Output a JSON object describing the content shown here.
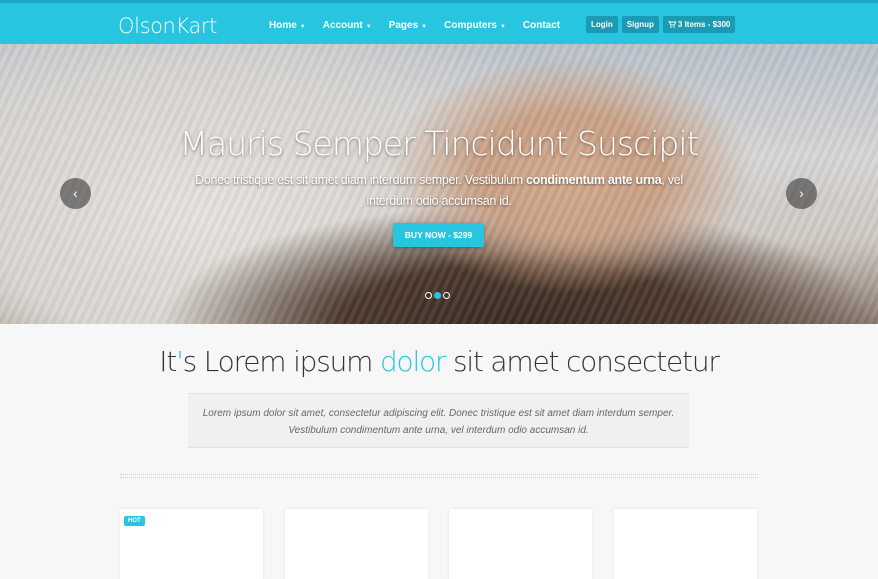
{
  "header": {
    "logo": "OlsonKart",
    "menu": [
      {
        "label": "Home",
        "dropdown": true
      },
      {
        "label": "Account",
        "dropdown": true
      },
      {
        "label": "Pages",
        "dropdown": true
      },
      {
        "label": "Computers",
        "dropdown": true
      },
      {
        "label": "Contact",
        "dropdown": false
      }
    ],
    "login_label": "Login",
    "signup_label": "Signup",
    "cart_label": "3 Items - $300",
    "cart_icon": "shopping-cart-icon"
  },
  "hero": {
    "title": "Mauris Semper Tincidunt Suscipit",
    "desc_part1": "Donec tristique est sit amet diam interdum semper. Vestibulum ",
    "desc_bold": "condimentum ante urna",
    "desc_part2": ", vel interdum odio accumsan id.",
    "button_label": "BUY NOW - $299",
    "prev_icon": "chevron-left-icon",
    "next_icon": "chevron-right-icon",
    "prev_glyph": "‹",
    "next_glyph": "›",
    "slide_count": 3,
    "active_slide": 2
  },
  "intro": {
    "tagline_pre": "It",
    "tagline_apos": "'",
    "tagline_mid": "s Lorem ipsum ",
    "tagline_accent": "dolor",
    "tagline_post": " sit amet consectetur",
    "text": "Lorem ipsum dolor sit amet, consectetur adipiscing elit. Donec tristique est sit amet diam interdum semper. Vestibulum condimentum ante urna, vel interdum odio accumsan id."
  },
  "products": [
    {
      "badge": "HOT"
    },
    {
      "badge": ""
    },
    {
      "badge": ""
    },
    {
      "badge": ""
    }
  ],
  "colors": {
    "accent": "#27c5e0",
    "nav_dark": "#1a9bb3"
  }
}
